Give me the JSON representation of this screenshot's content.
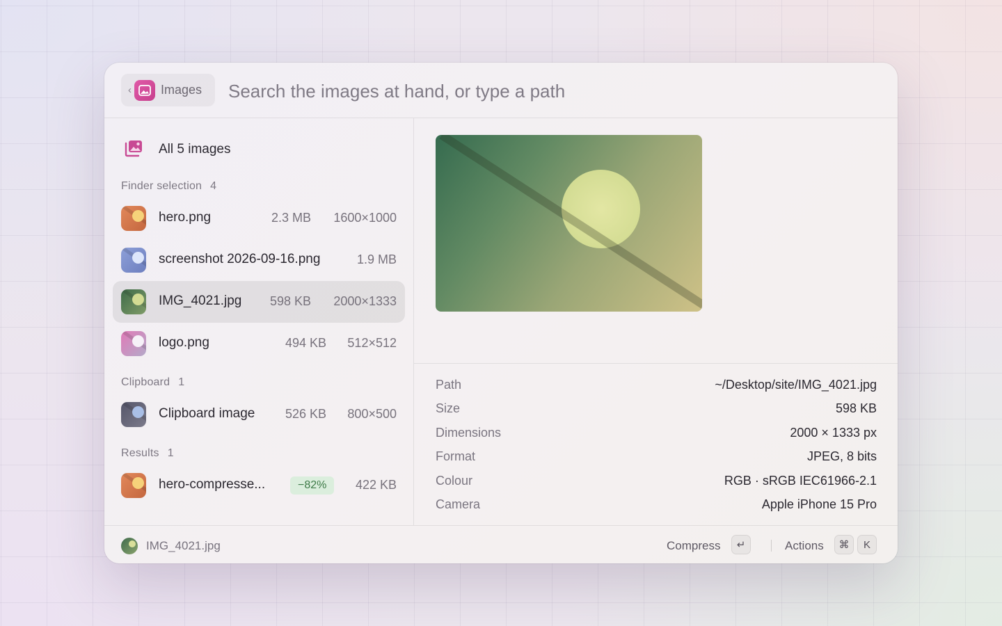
{
  "scope": {
    "back_glyph": "‹",
    "icon": "images-app-icon",
    "label": "Images"
  },
  "search": {
    "placeholder": "Search the images at hand, or type a path",
    "value": ""
  },
  "all_images": {
    "label": "All 5 images",
    "icon": "image-stack-icon"
  },
  "sections": {
    "finder": {
      "label": "Finder selection",
      "count": "4"
    },
    "clipboard": {
      "label": "Clipboard",
      "count": "1"
    },
    "results": {
      "label": "Results",
      "count": "1"
    }
  },
  "items": [
    {
      "name": "hero.png",
      "size": "2.3 MB",
      "dims": "1600×1000",
      "colors": [
        "#e2885a",
        "#c4673f",
        "#f6d27a"
      ]
    },
    {
      "name": "screenshot 2026-09-16.png",
      "size": "1.9 MB",
      "dims": "",
      "colors": [
        "#8d9fd8",
        "#6d7fbf",
        "#dde6fb"
      ]
    },
    {
      "name": "IMG_4021.jpg",
      "size": "598 KB",
      "dims": "2000×1333",
      "colors": [
        "#5f8a5a",
        "#3e6b48",
        "#d3dc93"
      ],
      "selected": true
    },
    {
      "name": "logo.png",
      "size": "494 KB",
      "dims": "512×512",
      "colors": [
        "#e07ab7",
        "#b4a9c9",
        "#f6f1f8"
      ]
    },
    {
      "name": "Clipboard image",
      "size": "526 KB",
      "dims": "800×500",
      "colors": [
        "#6f6e80",
        "#55566a",
        "#a9bfe6"
      ]
    },
    {
      "name": "hero-compresse...",
      "size": "422 KB",
      "badge": "−82%",
      "colors": [
        "#e2885a",
        "#c4673f",
        "#f6d27a"
      ]
    }
  ],
  "preview": {
    "alt": "IMG_4021.jpg"
  },
  "metadata": {
    "path": {
      "key": "Path",
      "value": "~/Desktop/site/IMG_4021.jpg"
    },
    "size": {
      "key": "Size",
      "value": "598 KB"
    },
    "dimensions": {
      "key": "Dimensions",
      "value": "2000 × 1333 px"
    },
    "format": {
      "key": "Format",
      "value": "JPEG, 8 bits"
    },
    "colour": {
      "key": "Colour",
      "value": "RGB · sRGB IEC61966-2.1"
    },
    "camera": {
      "key": "Camera",
      "value": "Apple iPhone 15 Pro"
    }
  },
  "footer": {
    "selected_name": "IMG_4021.jpg",
    "primary_action": "Compress",
    "primary_key": "↵",
    "actions_label": "Actions",
    "actions_keys": [
      "⌘",
      "K"
    ]
  }
}
